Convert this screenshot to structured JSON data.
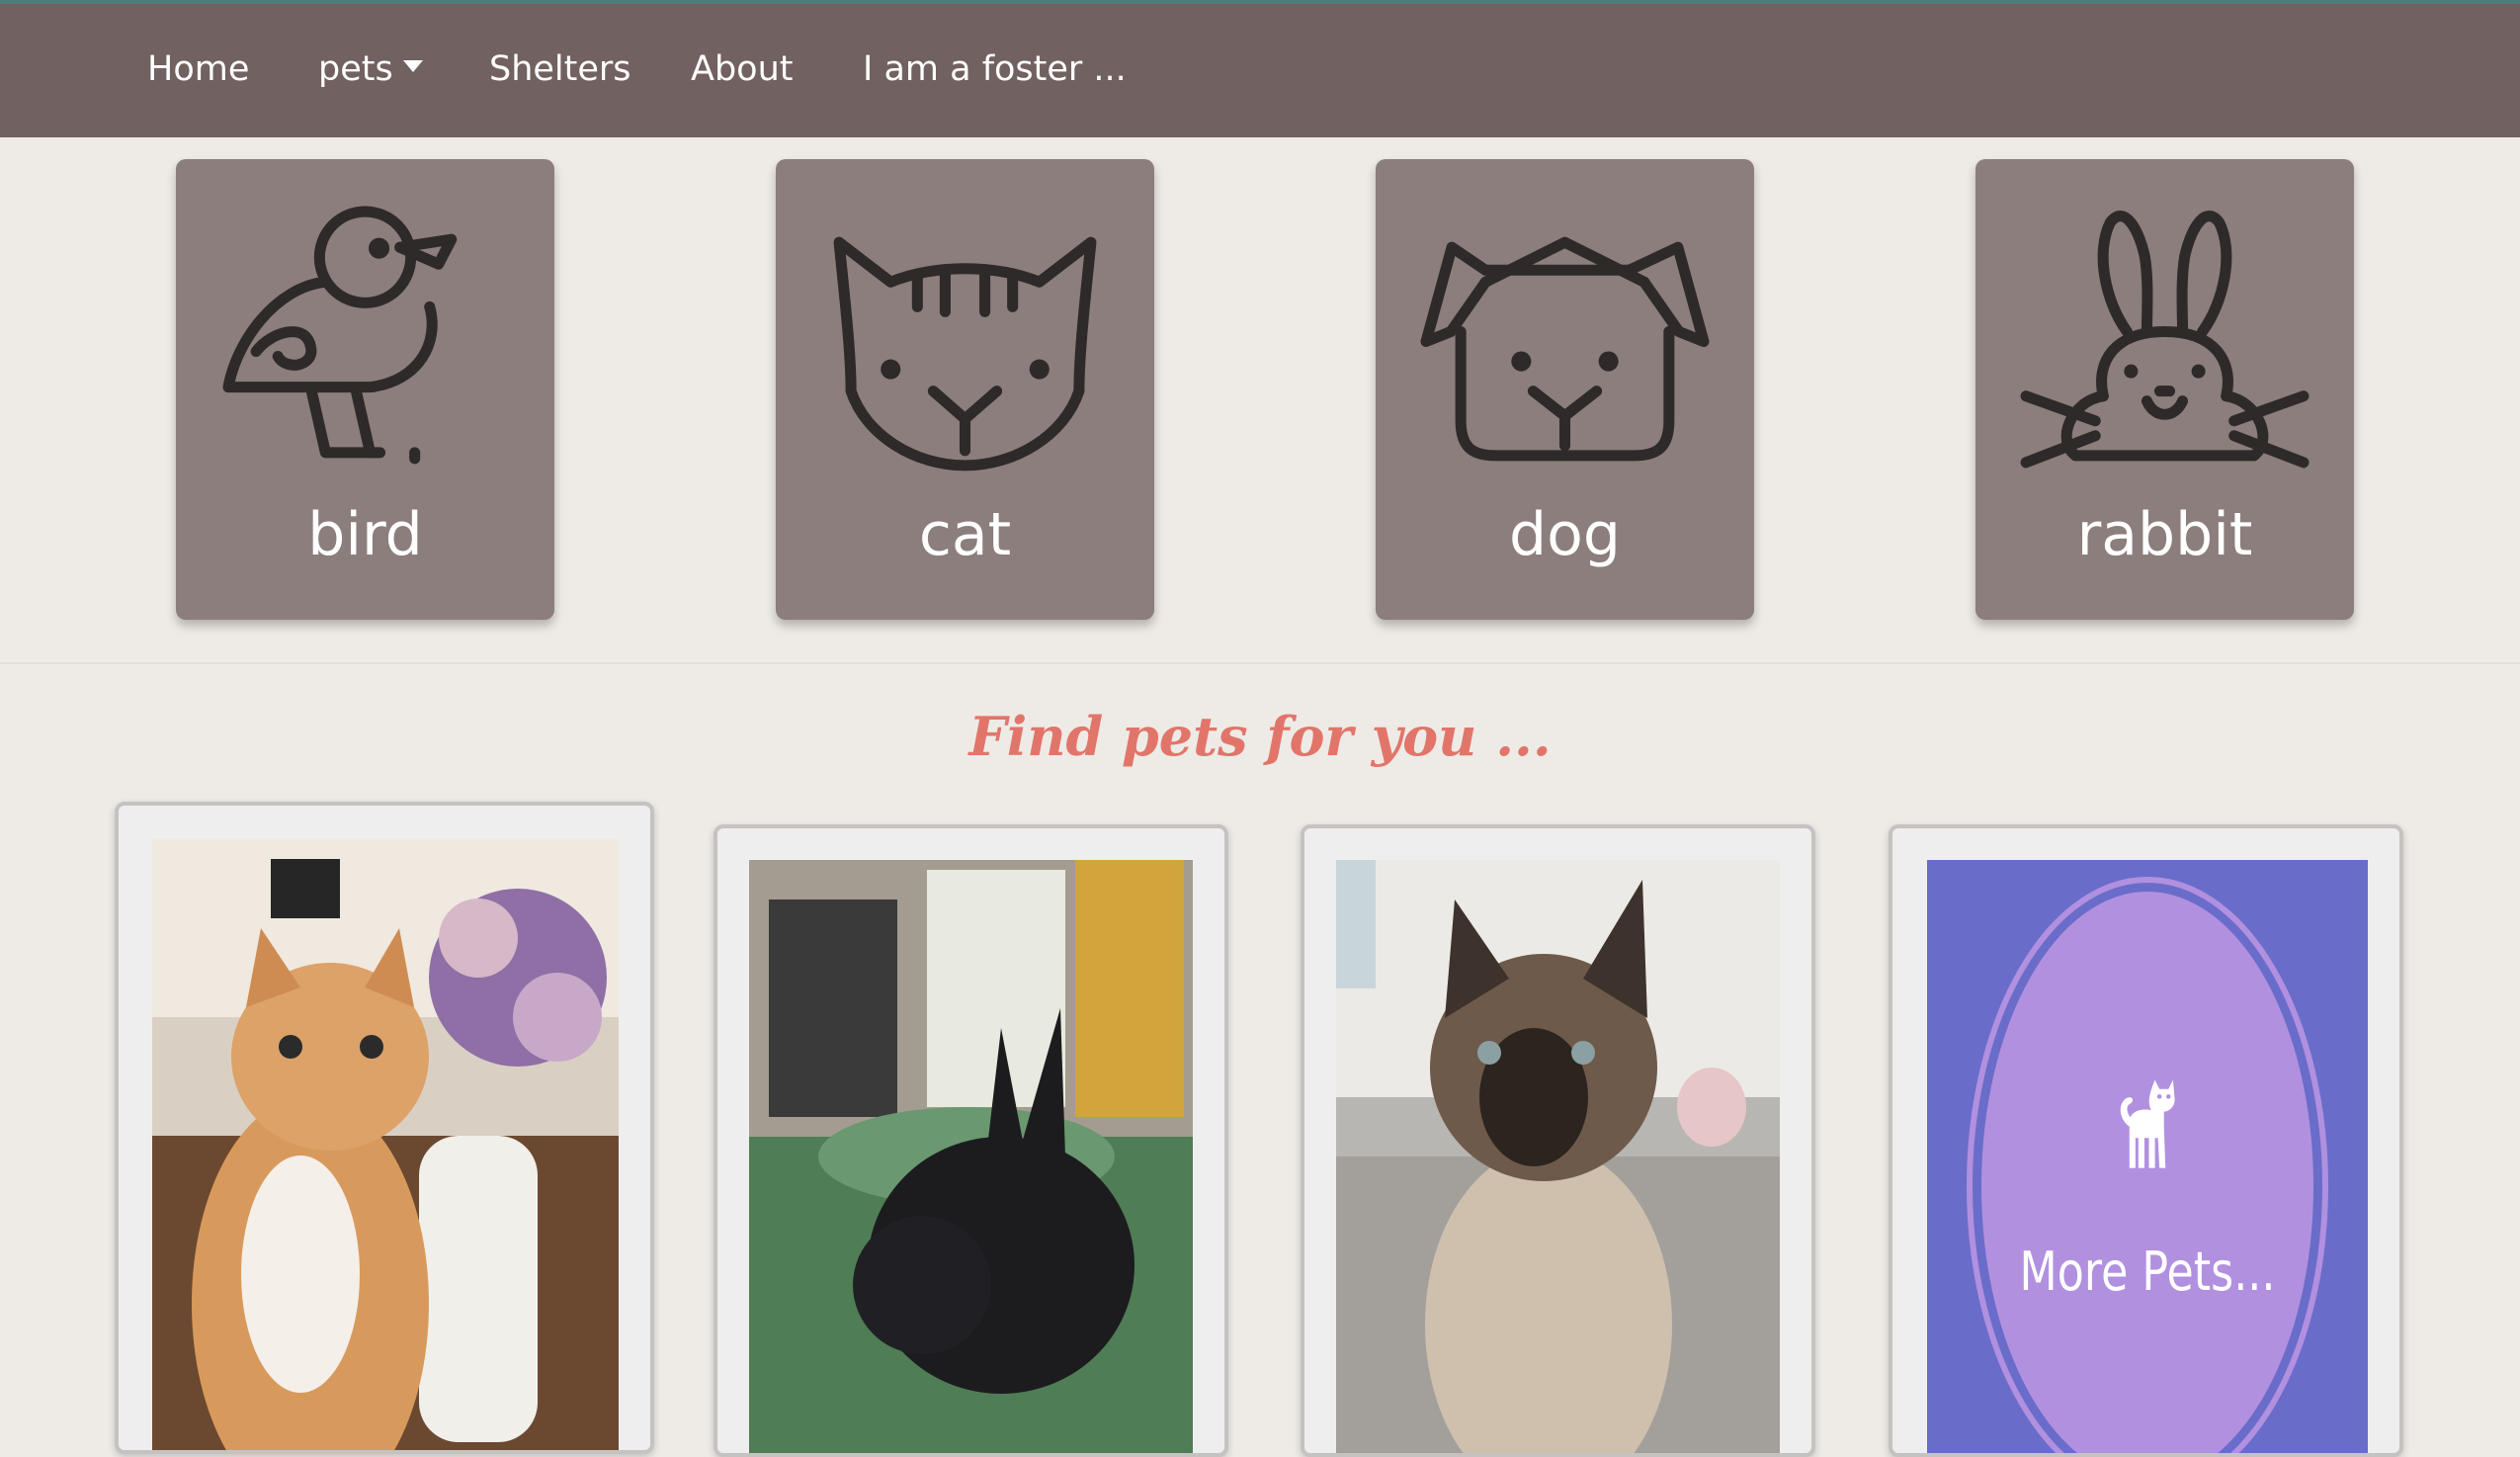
{
  "navbar": {
    "items": [
      {
        "label": "Home"
      },
      {
        "label": "pets"
      },
      {
        "label": "Shelters"
      },
      {
        "label": "About"
      },
      {
        "label": "I am a foster ..."
      }
    ]
  },
  "categories": [
    {
      "label": "bird",
      "icon": "bird-icon"
    },
    {
      "label": "cat",
      "icon": "cat-face-icon"
    },
    {
      "label": "dog",
      "icon": "dog-face-icon"
    },
    {
      "label": "rabbit",
      "icon": "rabbit-face-icon"
    }
  ],
  "section": {
    "title": "Find pets for you ..."
  },
  "pets": [
    {
      "photo": "orange-tabby-cat-photo"
    },
    {
      "photo": "black-rabbit-photo"
    },
    {
      "photo": "siamese-cat-photo"
    },
    {
      "photo": "more-pets-tile",
      "label": "More Pets..."
    }
  ],
  "colors": {
    "navbar": "#726161",
    "tile": "#8b7e7c",
    "background": "#eeebe7",
    "accent_title": "#e2756a",
    "more_pets_bg": "#6a6cc9",
    "more_pets_circle": "#b190e0"
  }
}
